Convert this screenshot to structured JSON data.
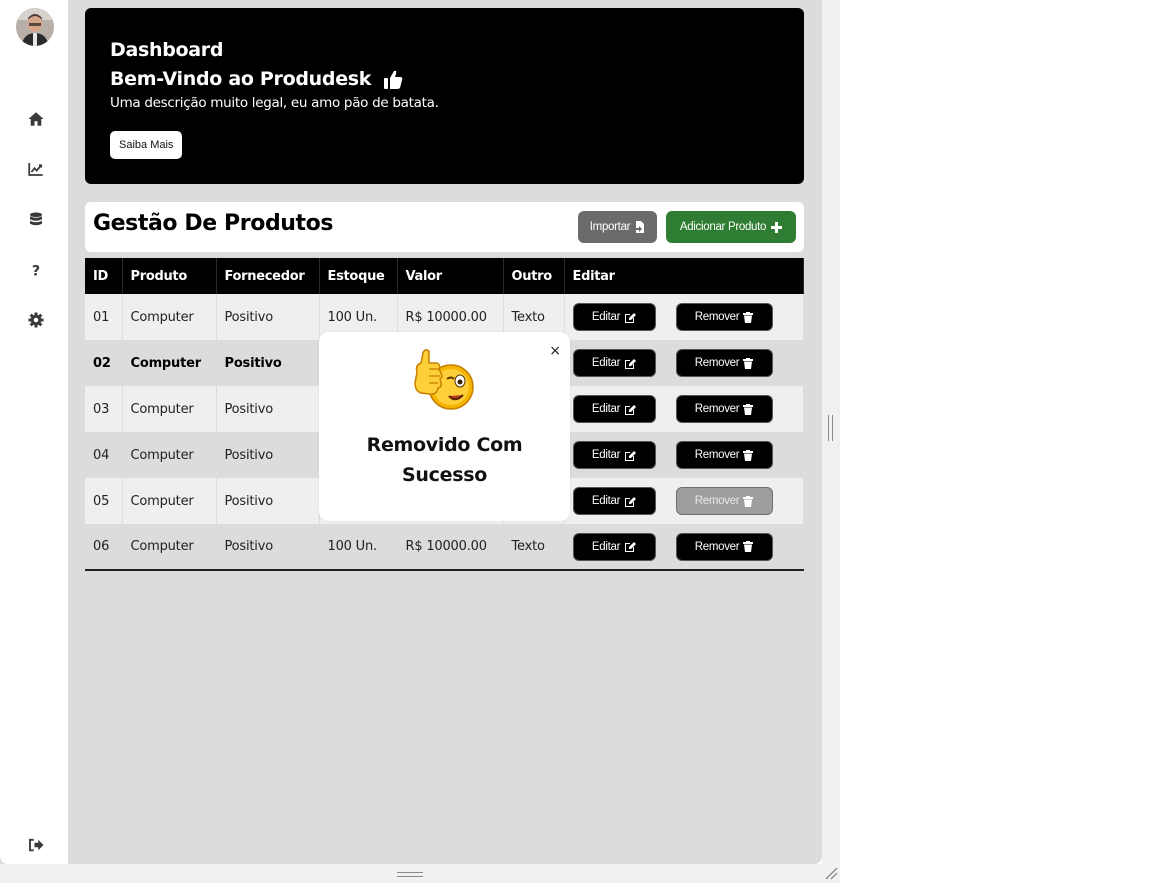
{
  "sidebar": {
    "items": [
      {
        "icon": "home-icon"
      },
      {
        "icon": "chart-line-icon"
      },
      {
        "icon": "database-icon"
      },
      {
        "icon": "question-icon"
      },
      {
        "icon": "gear-icon"
      }
    ],
    "logout_icon": "sign-out-icon"
  },
  "hero": {
    "title": "Dashboard",
    "welcome": "Bem-Vindo ao Produdesk",
    "description": "Uma descrição muito legal, eu amo pão de batata.",
    "learn_more": "Saiba Mais"
  },
  "management": {
    "title": "Gestão De Produtos",
    "import_label": "Importar",
    "add_label": "Adicionar Produto"
  },
  "table": {
    "headers": [
      "ID",
      "Produto",
      "Fornecedor",
      "Estoque",
      "Valor",
      "Outro",
      "Editar"
    ],
    "edit_label": "Editar",
    "remove_label": "Remover",
    "rows": [
      {
        "id": "01",
        "produto": "Computer",
        "fornecedor": "Positivo",
        "estoque": "100 Un.",
        "valor": "R$ 10000.00",
        "outro": "Texto"
      },
      {
        "id": "02",
        "produto": "Computer",
        "fornecedor": "Positivo",
        "estoque": "",
        "valor": "",
        "outro": ""
      },
      {
        "id": "03",
        "produto": "Computer",
        "fornecedor": "Positivo",
        "estoque": "",
        "valor": "",
        "outro": ""
      },
      {
        "id": "04",
        "produto": "Computer",
        "fornecedor": "Positivo",
        "estoque": "",
        "valor": "",
        "outro": ""
      },
      {
        "id": "05",
        "produto": "Computer",
        "fornecedor": "Positivo",
        "estoque": "",
        "valor": "",
        "outro": ""
      },
      {
        "id": "06",
        "produto": "Computer",
        "fornecedor": "Positivo",
        "estoque": "100 Un.",
        "valor": "R$ 10000.00",
        "outro": "Texto"
      }
    ]
  },
  "toast": {
    "message": "Removido Com Sucesso",
    "close": "×",
    "emoji": "thumbs-up-wink-emoji"
  },
  "colors": {
    "primary": "#000000",
    "success": "#2e7d32",
    "secondary": "#6b6b6b",
    "background": "#dcdcdc"
  }
}
